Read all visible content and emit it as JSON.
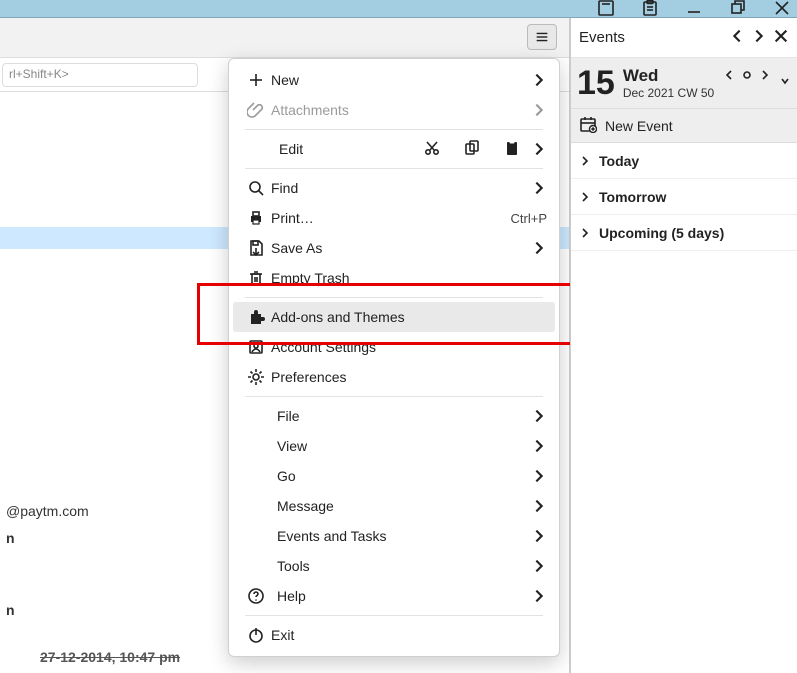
{
  "titlebar": {},
  "search": {
    "placeholder": "rl+Shift+K>"
  },
  "menu": {
    "new_label": "New",
    "attachments_label": "Attachments",
    "edit_label": "Edit",
    "find_label": "Find",
    "print_label": "Print…",
    "print_shortcut": "Ctrl+P",
    "saveas_label": "Save As",
    "empty_trash_label": "Empty Trash",
    "addons_label": "Add-ons and Themes",
    "account_settings_label": "Account Settings",
    "preferences_label": "Preferences",
    "file_label": "File",
    "view_label": "View",
    "go_label": "Go",
    "message_label": "Message",
    "events_tasks_label": "Events and Tasks",
    "tools_label": "Tools",
    "help_label": "Help",
    "exit_label": "Exit"
  },
  "events": {
    "title": "Events",
    "day_num": "15",
    "day_name": "Wed",
    "date_sub": "Dec 2021  CW 50",
    "new_event": "New Event",
    "today": "Today",
    "tomorrow": "Tomorrow",
    "upcoming": "Upcoming (5 days)"
  },
  "lower": {
    "email": "@paytm.com",
    "n": "n",
    "date_line": "27-12-2014, 10:47 pm"
  }
}
